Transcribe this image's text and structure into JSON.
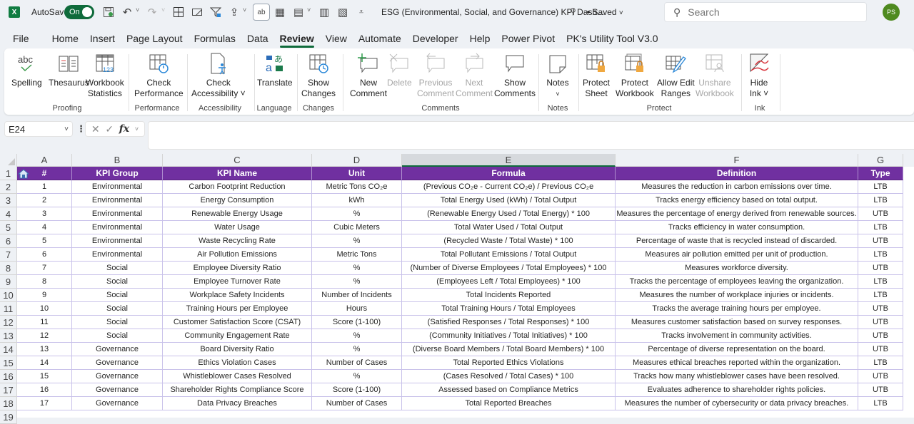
{
  "titlebar": {
    "app_icon": "excel-logo",
    "autosave_label": "AutoSave",
    "autosave_state": "On",
    "document_title": "ESG (Environmental, Social, and Governance) KPI Dash...",
    "save_status": "• Saved",
    "search_placeholder": "Search",
    "user_initials": "PS"
  },
  "menu_tabs": [
    "File",
    "Home",
    "Insert",
    "Page Layout",
    "Formulas",
    "Data",
    "Review",
    "View",
    "Automate",
    "Developer",
    "Help",
    "Power Pivot",
    "PK's Utility Tool V3.0"
  ],
  "active_tab": "Review",
  "ribbon": {
    "groups": [
      {
        "label": "Proofing",
        "buttons": [
          {
            "label": "Spelling",
            "icon": "spelling-icon"
          },
          {
            "label": "Thesaurus",
            "icon": "thesaurus-icon"
          },
          {
            "label": "Workbook\nStatistics",
            "label1": "Workbook",
            "label2": "Statistics",
            "icon": "workbook-statistics-icon"
          }
        ]
      },
      {
        "label": "Performance",
        "buttons": [
          {
            "label1": "Check",
            "label2": "Performance",
            "icon": "check-performance-icon"
          }
        ]
      },
      {
        "label": "Accessibility",
        "buttons": [
          {
            "label1": "Check",
            "label2": "Accessibility ˅",
            "icon": "check-accessibility-icon"
          }
        ]
      },
      {
        "label": "Language",
        "buttons": [
          {
            "label1": "Translate",
            "icon": "translate-icon"
          }
        ]
      },
      {
        "label": "Changes",
        "buttons": [
          {
            "label1": "Show",
            "label2": "Changes",
            "icon": "show-changes-icon"
          }
        ]
      },
      {
        "label": "Comments",
        "buttons": [
          {
            "label1": "New",
            "label2": "Comment",
            "icon": "new-comment-icon",
            "enabled": true
          },
          {
            "label1": "Delete",
            "icon": "delete-comment-icon",
            "enabled": false
          },
          {
            "label1": "Previous",
            "label2": "Comment",
            "icon": "previous-comment-icon",
            "enabled": false
          },
          {
            "label1": "Next",
            "label2": "Comment",
            "icon": "next-comment-icon",
            "enabled": false
          },
          {
            "label1": "Show",
            "label2": "Comments",
            "icon": "show-comments-icon",
            "enabled": true
          }
        ]
      },
      {
        "label": "Notes",
        "buttons": [
          {
            "label1": "Notes",
            "label2": "˅",
            "icon": "notes-icon"
          }
        ]
      },
      {
        "label": "Protect",
        "buttons": [
          {
            "label1": "Protect",
            "label2": "Sheet",
            "icon": "protect-sheet-icon",
            "enabled": true
          },
          {
            "label1": "Protect",
            "label2": "Workbook",
            "icon": "protect-workbook-icon",
            "enabled": true
          },
          {
            "label1": "Allow Edit",
            "label2": "Ranges",
            "icon": "allow-edit-ranges-icon",
            "enabled": true
          },
          {
            "label1": "Unshare",
            "label2": "Workbook",
            "icon": "unshare-workbook-icon",
            "enabled": false
          }
        ]
      },
      {
        "label": "Ink",
        "buttons": [
          {
            "label1": "Hide",
            "label2": "Ink ˅",
            "icon": "hide-ink-icon"
          }
        ]
      }
    ]
  },
  "formula_bar": {
    "name_box": "E24",
    "formula": ""
  },
  "sheet": {
    "columns": [
      "A",
      "B",
      "C",
      "D",
      "E",
      "F",
      "G"
    ],
    "selected_column": "E",
    "header_fill": "#7030a0",
    "border_color": "#c9c2ea",
    "headers": [
      "#",
      "KPI Group",
      "KPI Name",
      "Unit",
      "Formula",
      "Definition",
      "Type"
    ],
    "rows": [
      [
        "1",
        "Environmental",
        "Carbon Footprint Reduction",
        "Metric Tons CO₂e",
        "(Previous CO₂e - Current CO₂e) / Previous CO₂e",
        "Measures the reduction in carbon emissions over time.",
        "LTB"
      ],
      [
        "2",
        "Environmental",
        "Energy Consumption",
        "kWh",
        "Total Energy Used (kWh) / Total Output",
        "Tracks energy efficiency based on total output.",
        "LTB"
      ],
      [
        "3",
        "Environmental",
        "Renewable Energy Usage",
        "%",
        "(Renewable Energy Used / Total Energy) * 100",
        "Measures the percentage of energy derived from renewable sources.",
        "UTB"
      ],
      [
        "4",
        "Environmental",
        "Water Usage",
        "Cubic Meters",
        "Total Water Used / Total Output",
        "Tracks efficiency in water consumption.",
        "LTB"
      ],
      [
        "5",
        "Environmental",
        "Waste Recycling Rate",
        "%",
        "(Recycled Waste / Total Waste) * 100",
        "Percentage of waste that is recycled instead of discarded.",
        "UTB"
      ],
      [
        "6",
        "Environmental",
        "Air Pollution Emissions",
        "Metric Tons",
        "Total Pollutant Emissions / Total Output",
        "Measures air pollution emitted per unit of production.",
        "LTB"
      ],
      [
        "7",
        "Social",
        "Employee Diversity Ratio",
        "%",
        "(Number of Diverse Employees / Total Employees) * 100",
        "Measures workforce diversity.",
        "UTB"
      ],
      [
        "8",
        "Social",
        "Employee Turnover Rate",
        "%",
        "(Employees Left / Total Employees) * 100",
        "Tracks the percentage of employees leaving the organization.",
        "LTB"
      ],
      [
        "9",
        "Social",
        "Workplace Safety Incidents",
        "Number of Incidents",
        "Total Incidents Reported",
        "Measures the number of workplace injuries or incidents.",
        "LTB"
      ],
      [
        "10",
        "Social",
        "Training Hours per Employee",
        "Hours",
        "Total Training Hours / Total Employees",
        "Tracks the average training hours per employee.",
        "UTB"
      ],
      [
        "11",
        "Social",
        "Customer Satisfaction Score (CSAT)",
        "Score (1-100)",
        "(Satisfied Responses / Total Responses) * 100",
        "Measures customer satisfaction based on survey responses.",
        "UTB"
      ],
      [
        "12",
        "Social",
        "Community Engagement Rate",
        "%",
        "(Community Initiatives / Total Initiatives) * 100",
        "Tracks involvement in community activities.",
        "UTB"
      ],
      [
        "13",
        "Governance",
        "Board Diversity Ratio",
        "%",
        "(Diverse Board Members / Total Board Members) * 100",
        "Percentage of diverse representation on the board.",
        "UTB"
      ],
      [
        "14",
        "Governance",
        "Ethics Violation Cases",
        "Number of Cases",
        "Total Reported Ethics Violations",
        "Measures ethical breaches reported within the organization.",
        "LTB"
      ],
      [
        "15",
        "Governance",
        "Whistleblower Cases Resolved",
        "%",
        "(Cases Resolved / Total Cases) * 100",
        "Tracks how many whistleblower cases have been resolved.",
        "UTB"
      ],
      [
        "16",
        "Governance",
        "Shareholder Rights Compliance Score",
        "Score (1-100)",
        "Assessed based on Compliance Metrics",
        "Evaluates adherence to shareholder rights policies.",
        "UTB"
      ],
      [
        "17",
        "Governance",
        "Data Privacy Breaches",
        "Number of Cases",
        "Total Reported Breaches",
        "Measures the number of cybersecurity or data privacy breaches.",
        "LTB"
      ]
    ],
    "row_numbers": [
      "1",
      "2",
      "3",
      "4",
      "5",
      "6",
      "7",
      "8",
      "9",
      "10",
      "11",
      "12",
      "13",
      "14",
      "15",
      "16",
      "17",
      "18",
      "19"
    ]
  }
}
